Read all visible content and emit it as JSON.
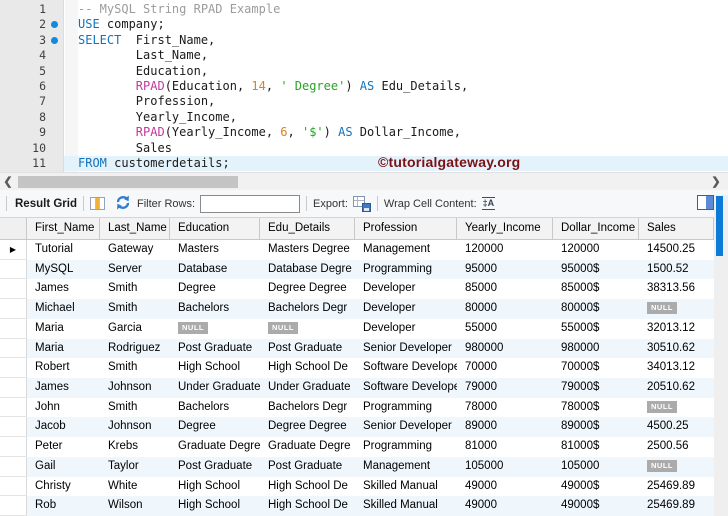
{
  "editor": {
    "lines": [
      {
        "n": "1",
        "seg": [
          [
            "comment",
            "-- MySQL String RPAD Example"
          ]
        ]
      },
      {
        "n": "2",
        "mark": true,
        "seg": [
          [
            "kw",
            "USE"
          ],
          [
            "plain",
            " company;"
          ]
        ]
      },
      {
        "n": "3",
        "mark": true,
        "seg": [
          [
            "kw",
            "SELECT"
          ],
          [
            "plain",
            "  First_Name,"
          ]
        ]
      },
      {
        "n": "4",
        "seg": [
          [
            "plain",
            "        Last_Name,"
          ]
        ]
      },
      {
        "n": "5",
        "seg": [
          [
            "plain",
            "        Education,"
          ]
        ]
      },
      {
        "n": "6",
        "seg": [
          [
            "plain",
            "        "
          ],
          [
            "fn",
            "RPAD"
          ],
          [
            "plain",
            "(Education, "
          ],
          [
            "num",
            "14"
          ],
          [
            "plain",
            ", "
          ],
          [
            "str",
            "' Degree'"
          ],
          [
            "plain",
            ") "
          ],
          [
            "kw",
            "AS"
          ],
          [
            "plain",
            " Edu_Details,"
          ]
        ]
      },
      {
        "n": "7",
        "seg": [
          [
            "plain",
            "        Profession,"
          ]
        ]
      },
      {
        "n": "8",
        "seg": [
          [
            "plain",
            "        Yearly_Income,"
          ]
        ]
      },
      {
        "n": "9",
        "seg": [
          [
            "plain",
            "        "
          ],
          [
            "fn",
            "RPAD"
          ],
          [
            "plain",
            "(Yearly_Income, "
          ],
          [
            "num",
            "6"
          ],
          [
            "plain",
            ", "
          ],
          [
            "str",
            "'$'"
          ],
          [
            "plain",
            ") "
          ],
          [
            "kw",
            "AS"
          ],
          [
            "plain",
            " Dollar_Income,"
          ]
        ]
      },
      {
        "n": "10",
        "seg": [
          [
            "plain",
            "        Sales"
          ]
        ]
      },
      {
        "n": "11",
        "hl": true,
        "seg": [
          [
            "kw",
            "FROM"
          ],
          [
            "plain",
            " customerdetails;"
          ]
        ]
      }
    ]
  },
  "watermark": "©tutorialgateway.org",
  "scrollbar": {
    "left_arrow": "❮",
    "right_arrow": "❯"
  },
  "toolbar": {
    "result_grid_label": "Result Grid",
    "filter_label": "Filter Rows:",
    "filter_value": "",
    "export_label": "Export:",
    "wrap_label": "Wrap Cell Content:",
    "wrap_icon_glyph": "‡A"
  },
  "grid": {
    "null_badge": "NULL",
    "row_marker": "▶",
    "columns": [
      "First_Name",
      "Last_Name",
      "Education",
      "Edu_Details",
      "Profession",
      "Yearly_Income",
      "Dollar_Income",
      "Sales"
    ],
    "rows": [
      [
        "Tutorial",
        "Gateway",
        "Masters",
        "Masters Degree",
        "Management",
        "120000",
        "120000",
        "14500.25"
      ],
      [
        "MySQL",
        "Server",
        "Database",
        "Database Degre",
        "Programming",
        "95000",
        "95000$",
        "1500.52"
      ],
      [
        "James",
        "Smith",
        "Degree",
        "Degree Degree",
        "Developer",
        "85000",
        "85000$",
        "38313.56"
      ],
      [
        "Michael",
        "Smith",
        "Bachelors",
        "Bachelors Degr",
        "Developer",
        "80000",
        "80000$",
        null
      ],
      [
        "Maria",
        "Garcia",
        null,
        null,
        "Developer",
        "55000",
        "55000$",
        "32013.12"
      ],
      [
        "Maria",
        "Rodriguez",
        "Post Graduate",
        "Post Graduate",
        "Senior Developer",
        "980000",
        "980000",
        "30510.62"
      ],
      [
        "Robert",
        "Smith",
        "High School",
        "High School De",
        "Software Developer",
        "70000",
        "70000$",
        "34013.12"
      ],
      [
        "James",
        "Johnson",
        "Under Graduate",
        "Under Graduate",
        "Software Developer",
        "79000",
        "79000$",
        "20510.62"
      ],
      [
        "John",
        "Smith",
        "Bachelors",
        "Bachelors Degr",
        "Programming",
        "78000",
        "78000$",
        null
      ],
      [
        "Jacob",
        "Johnson",
        "Degree",
        "Degree Degree",
        "Senior Developer",
        "89000",
        "89000$",
        "4500.25"
      ],
      [
        "Peter",
        "Krebs",
        "Graduate Degree",
        "Graduate Degre",
        "Programming",
        "81000",
        "81000$",
        "2500.56"
      ],
      [
        "Gail",
        "Taylor",
        "Post Graduate",
        "Post Graduate",
        "Management",
        "105000",
        "105000",
        null
      ],
      [
        "Christy",
        "White",
        "High School",
        "High School De",
        "Skilled Manual",
        "49000",
        "49000$",
        "25469.89"
      ],
      [
        "Rob",
        "Wilson",
        "High School",
        "High School De",
        "Skilled Manual",
        "49000",
        "49000$",
        "25469.89"
      ]
    ]
  },
  "colors": {
    "accent_blue": "#0c7bd8",
    "alt_row": "#eff6fc",
    "watermark_red": "#7b1113",
    "null_badge_gray": "#ababab"
  }
}
